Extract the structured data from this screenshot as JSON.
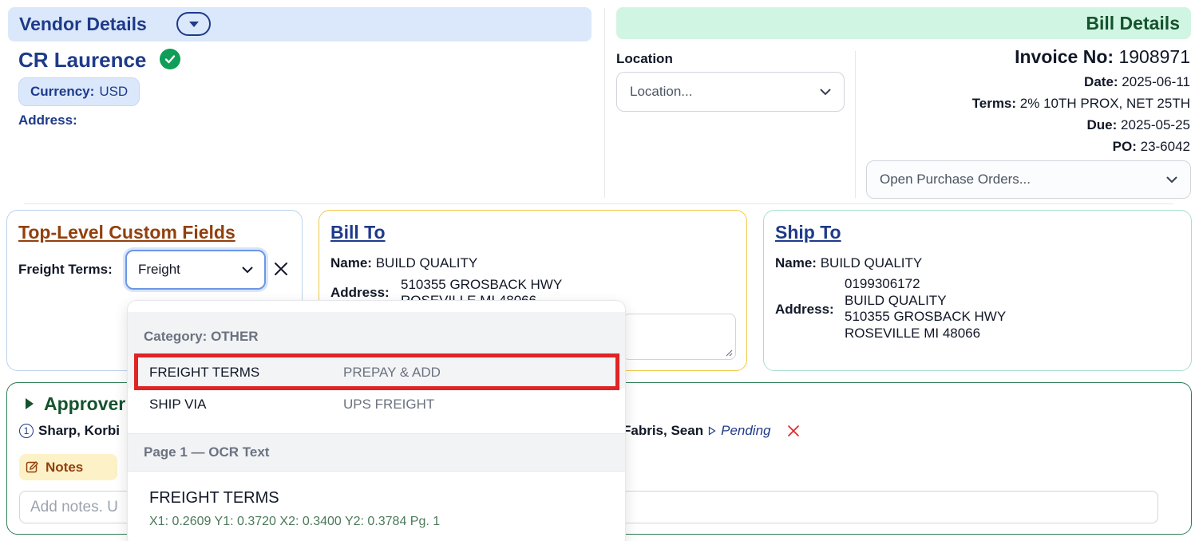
{
  "vendor": {
    "header": "Vendor Details",
    "name": "CR Laurence",
    "currency_label": "Currency:",
    "currency_value": "USD",
    "address_label": "Address:"
  },
  "bill": {
    "header": "Bill Details",
    "location_label": "Location",
    "location_placeholder": "Location...",
    "invoice_label": "Invoice No:",
    "invoice_value": "1908971",
    "date_label": "Date:",
    "date_value": "2025-06-11",
    "terms_label": "Terms:",
    "terms_value": "2% 10TH PROX, NET 25TH",
    "due_label": "Due:",
    "due_value": "2025-05-25",
    "po_label": "PO:",
    "po_value": "23-6042",
    "po_select_placeholder": "Open Purchase Orders..."
  },
  "custom_fields": {
    "title": "Top-Level Custom Fields",
    "freight_label": "Freight Terms:",
    "freight_value": "Freight"
  },
  "bill_to": {
    "title": "Bill To",
    "name_label": "Name:",
    "name_value": "BUILD QUALITY",
    "address_label": "Address:",
    "address_line1": "510355 GROSBACK HWY",
    "address_line2": "ROSEVILLE MI 48066"
  },
  "ship_to": {
    "title": "Ship To",
    "name_label": "Name:",
    "name_value": "BUILD QUALITY",
    "address_label": "Address:",
    "address_lines": [
      "0199306172",
      "BUILD QUALITY",
      "510355 GROSBACK HWY",
      "ROSEVILLE MI 48066"
    ]
  },
  "approvers": {
    "title": "Approver",
    "first_number": "1",
    "first_name": "Sharp, Korbi",
    "second_name": "Fabris, Sean",
    "second_status": "Pending",
    "notes_label": "Notes",
    "notes_placeholder": "Add notes. U"
  },
  "dropdown": {
    "category_header": "Category: OTHER",
    "options": [
      {
        "key": "FREIGHT TERMS",
        "value": "PREPAY & ADD"
      },
      {
        "key": "SHIP VIA",
        "value": "UPS FREIGHT"
      }
    ],
    "page_header": "Page 1 — OCR Text",
    "ocr_title": "FREIGHT TERMS",
    "ocr_coords": "X1: 0.2609 Y1: 0.3720 X2: 0.3400 Y2: 0.3784 Pg. 1"
  },
  "colors": {
    "vendor_accent": "#1e3a8a",
    "bill_accent": "#14532d",
    "highlight": "#e02424",
    "custom_fields_title": "#92400e"
  }
}
